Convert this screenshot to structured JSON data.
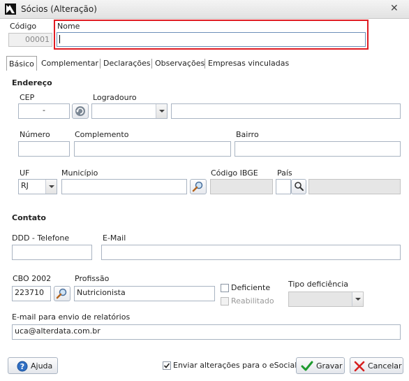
{
  "window": {
    "title": "Sócios (Alteração)"
  },
  "header": {
    "codigo_label": "Código",
    "codigo_value": "00001",
    "nome_label": "Nome",
    "nome_value": ""
  },
  "tabs": [
    {
      "label": "Básico",
      "active": true
    },
    {
      "label": "Complementar"
    },
    {
      "label": "Declarações"
    },
    {
      "label": "Observações"
    },
    {
      "label": "Empresas vinculadas"
    }
  ],
  "endereco": {
    "section_title": "Endereço",
    "cep_label": "CEP",
    "cep_value": "-",
    "logradouro_label": "Logradouro",
    "logradouro_type": "",
    "logradouro_value": "",
    "numero_label": "Número",
    "numero_value": "",
    "complemento_label": "Complemento",
    "complemento_value": "",
    "bairro_label": "Bairro",
    "bairro_value": "",
    "uf_label": "UF",
    "uf_value": "RJ",
    "municipio_label": "Município",
    "municipio_value": "",
    "ibge_label": "Código IBGE",
    "ibge_value": "",
    "pais_label": "País",
    "pais_code": "",
    "pais_name": ""
  },
  "contato": {
    "section_title": "Contato",
    "telefone_label": "DDD - Telefone",
    "telefone_value": "",
    "email_label": "E-Mail",
    "email_value": "",
    "cbo_label": "CBO 2002",
    "cbo_value": "223710",
    "profissao_label": "Profissão",
    "profissao_value": "Nutricionista",
    "deficiente_label": "Deficiente",
    "deficiente_checked": false,
    "reabilitado_label": "Reabilitado",
    "reabilitado_checked": false,
    "tipo_deficiencia_label": "Tipo deficiência",
    "tipo_deficiencia_value": "",
    "relatorio_email_label": "E-mail para envio de relatórios",
    "relatorio_email_value": "uca@alterdata.com.br"
  },
  "footer": {
    "help_label": "Ajuda",
    "esocial_label": "Enviar alterações para o eSocial",
    "esocial_checked": true,
    "save_label": "Gravar",
    "cancel_label": "Cancelar"
  }
}
